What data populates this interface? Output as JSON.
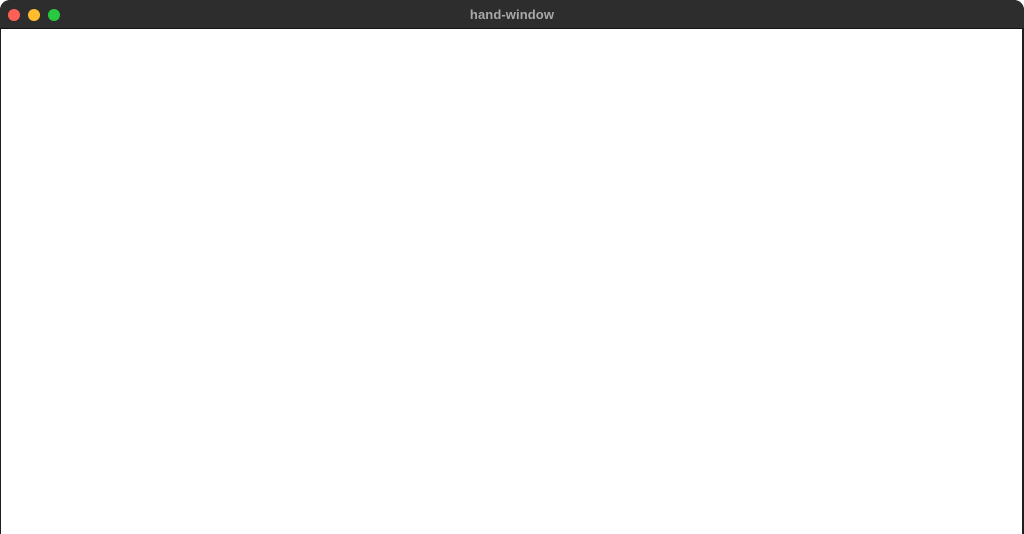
{
  "window": {
    "title": "hand-window",
    "buttons": [
      {
        "name": "close",
        "color": "#fe5f57"
      },
      {
        "name": "minimize",
        "color": "#febc2e"
      },
      {
        "name": "zoom",
        "color": "#28c840"
      }
    ]
  },
  "colors": {
    "titlebar": "#2d2d2d",
    "title_text": "#a9a9a9",
    "content_background": "#ffffff"
  }
}
